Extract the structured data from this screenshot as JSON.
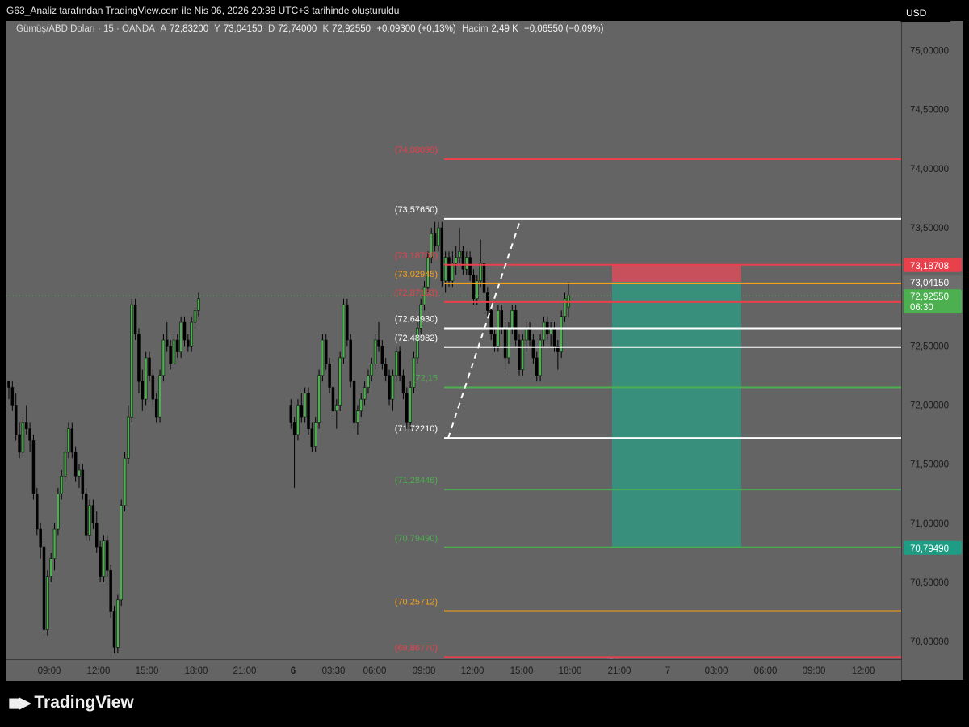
{
  "header": {
    "title": "G63_Analiz tarafından TradingView.com ile Nis 06, 2026 20:38 UTC+3 tarihinde oluşturuldu"
  },
  "legend": {
    "symbol": "Gümüş/ABD Doları · 15 · OANDA",
    "o_label": "A",
    "o_value": "72,83200",
    "h_label": "Y",
    "h_value": "73,04150",
    "l_label": "D",
    "l_value": "72,74000",
    "c_label": "K",
    "c_value": "72,92550",
    "change": "+0,09300 (+0,13%)",
    "volume_label": "Hacim",
    "volume_value": "2,49 K",
    "volume_change": "−0,06550 (−0,09%)"
  },
  "currency": "USD",
  "brand": "TradingView",
  "chart_data": {
    "type": "candlestick",
    "symbol": "Gümüş/ABD Doları",
    "interval": "15",
    "exchange": "OANDA",
    "ylim": [
      69.85,
      75.25
    ],
    "y_ticks": [
      {
        "v": 75.0,
        "label": "75,00000"
      },
      {
        "v": 74.5,
        "label": "74,50000"
      },
      {
        "v": 74.0,
        "label": "74,00000"
      },
      {
        "v": 73.5,
        "label": "73,50000"
      },
      {
        "v": 72.5,
        "label": "72,50000"
      },
      {
        "v": 72.0,
        "label": "72,00000"
      },
      {
        "v": 71.5,
        "label": "71,50000"
      },
      {
        "v": 71.0,
        "label": "71,00000"
      },
      {
        "v": 70.5,
        "label": "70,50000"
      },
      {
        "v": 70.0,
        "label": "70,00000"
      }
    ],
    "x_ticks": [
      {
        "label": "09:00",
        "bold": false
      },
      {
        "label": "12:00",
        "bold": false
      },
      {
        "label": "15:00",
        "bold": false
      },
      {
        "label": "18:00",
        "bold": false
      },
      {
        "label": "21:00",
        "bold": false
      },
      {
        "label": "6",
        "bold": true
      },
      {
        "label": "03:30",
        "bold": false
      },
      {
        "label": "06:00",
        "bold": false
      },
      {
        "label": "09:00",
        "bold": false
      },
      {
        "label": "12:00",
        "bold": false
      },
      {
        "label": "15:00",
        "bold": false
      },
      {
        "label": "18:00",
        "bold": false
      },
      {
        "label": "21:00",
        "bold": false
      },
      {
        "label": "7",
        "bold": false
      },
      {
        "label": "03:00",
        "bold": false
      },
      {
        "label": "06:00",
        "bold": false
      },
      {
        "label": "09:00",
        "bold": false
      },
      {
        "label": "12:00",
        "bold": false
      }
    ],
    "levels": [
      {
        "value": 74.0809,
        "label": "(74,08090)",
        "color": "#e8414c"
      },
      {
        "value": 73.5765,
        "label": "(73,57650)",
        "color": "#ffffff"
      },
      {
        "value": 73.18708,
        "label": "(73,18708)",
        "color": "#e8414c"
      },
      {
        "value": 73.02945,
        "label": "(73,02945)",
        "color": "#f6a01a"
      },
      {
        "value": 72.87183,
        "label": "(72,87183)",
        "color": "#e8414c"
      },
      {
        "value": 72.6493,
        "label": "(72,64930)",
        "color": "#ffffff"
      },
      {
        "value": 72.48982,
        "label": "(72,48982)",
        "color": "#ffffff"
      },
      {
        "value": 72.15,
        "label": "(72,15",
        "color": "#4caf50"
      },
      {
        "value": 71.7221,
        "label": "(71,72210)",
        "color": "#ffffff"
      },
      {
        "value": 71.28446,
        "label": "(71,28446)",
        "color": "#4caf50"
      },
      {
        "value": 70.7949,
        "label": "(70,79490)",
        "color": "#4caf50"
      },
      {
        "value": 70.25712,
        "label": "(70,25712)",
        "color": "#f6a01a"
      },
      {
        "value": 69.8677,
        "label": "(69,86770)",
        "color": "#e8414c"
      }
    ],
    "position": {
      "type": "short",
      "entry": 73.0415,
      "stop": 73.18708,
      "target": 70.7949,
      "stop_color": "#d94c5a",
      "target_color": "#2a9d84"
    },
    "price_tags": [
      {
        "value": 73.18708,
        "label": "73,18708",
        "bg": "#e8414c",
        "fg": "#ffffff"
      },
      {
        "value": 73.0415,
        "label": "73,04150",
        "bg": "#6e6e6e",
        "fg": "#ffffff"
      },
      {
        "value": 72.9255,
        "label": "72,92550",
        "sub": "06:30",
        "bg": "#4caf50",
        "fg": "#ffffff"
      },
      {
        "value": 70.7949,
        "label": "70,79490",
        "bg": "#1f9d84",
        "fg": "#ffffff"
      }
    ],
    "last_price": 72.9255,
    "candle_colors": {
      "up": "#4caf50",
      "down": "#000000"
    },
    "candles": [
      [
        72.2,
        72.2,
        72.05,
        72.15
      ],
      [
        72.15,
        72.2,
        71.95,
        72.0
      ],
      [
        72.0,
        72.1,
        71.7,
        71.75
      ],
      [
        71.75,
        71.85,
        71.55,
        71.6
      ],
      [
        71.6,
        71.9,
        71.55,
        71.85
      ],
      [
        71.85,
        72.0,
        71.75,
        71.8
      ],
      [
        71.8,
        71.85,
        71.6,
        71.7
      ],
      [
        71.7,
        71.75,
        71.2,
        71.25
      ],
      [
        71.25,
        71.3,
        70.9,
        70.95
      ],
      [
        70.95,
        71.0,
        70.7,
        70.8
      ],
      [
        70.8,
        70.85,
        70.05,
        70.1
      ],
      [
        70.1,
        70.6,
        70.05,
        70.55
      ],
      [
        70.55,
        70.75,
        70.5,
        70.7
      ],
      [
        70.7,
        71.0,
        70.6,
        70.95
      ],
      [
        70.95,
        71.3,
        70.9,
        71.25
      ],
      [
        71.25,
        71.45,
        71.2,
        71.4
      ],
      [
        71.4,
        71.65,
        71.35,
        71.6
      ],
      [
        71.6,
        71.85,
        71.55,
        71.8
      ],
      [
        71.8,
        71.85,
        71.55,
        71.6
      ],
      [
        71.6,
        71.65,
        71.35,
        71.4
      ],
      [
        71.4,
        71.5,
        71.3,
        71.45
      ],
      [
        71.45,
        71.5,
        71.2,
        71.25
      ],
      [
        71.25,
        71.3,
        70.85,
        70.9
      ],
      [
        70.9,
        71.2,
        70.85,
        71.15
      ],
      [
        71.15,
        71.2,
        70.95,
        71.0
      ],
      [
        71.0,
        71.1,
        70.75,
        70.8
      ],
      [
        70.8,
        70.85,
        70.5,
        70.55
      ],
      [
        70.55,
        70.9,
        70.5,
        70.85
      ],
      [
        70.85,
        70.9,
        70.55,
        70.6
      ],
      [
        70.6,
        70.65,
        70.2,
        70.25
      ],
      [
        70.25,
        70.3,
        69.9,
        69.95
      ],
      [
        69.95,
        70.4,
        69.9,
        70.35
      ],
      [
        70.35,
        71.2,
        70.3,
        71.15
      ],
      [
        71.15,
        71.6,
        71.1,
        71.55
      ],
      [
        71.55,
        72.0,
        71.5,
        71.9
      ],
      [
        71.9,
        72.9,
        71.85,
        72.85
      ],
      [
        72.85,
        72.9,
        72.55,
        72.6
      ],
      [
        72.6,
        72.65,
        72.1,
        72.2
      ],
      [
        72.2,
        72.3,
        71.95,
        72.05
      ],
      [
        72.05,
        72.45,
        72.0,
        72.4
      ],
      [
        72.4,
        72.45,
        72.2,
        72.25
      ],
      [
        72.25,
        72.3,
        72.0,
        72.05
      ],
      [
        72.05,
        72.1,
        71.85,
        71.9
      ],
      [
        71.9,
        72.3,
        71.85,
        72.25
      ],
      [
        72.25,
        72.6,
        72.2,
        72.55
      ],
      [
        72.55,
        72.7,
        72.45,
        72.5
      ],
      [
        72.5,
        72.55,
        72.3,
        72.35
      ],
      [
        72.35,
        72.6,
        72.3,
        72.55
      ],
      [
        72.55,
        72.6,
        72.4,
        72.45
      ],
      [
        72.45,
        72.75,
        72.4,
        72.7
      ],
      [
        72.7,
        72.75,
        72.5,
        72.55
      ],
      [
        72.55,
        72.6,
        72.45,
        72.5
      ],
      [
        72.5,
        72.75,
        72.45,
        72.7
      ],
      [
        72.7,
        72.85,
        72.65,
        72.8
      ],
      [
        72.8,
        72.95,
        72.75,
        72.9
      ],
      [
        72.0,
        72.05,
        71.8,
        71.85
      ],
      [
        71.85,
        71.9,
        71.3,
        71.75
      ],
      [
        71.75,
        72.05,
        71.7,
        72.0
      ],
      [
        72.0,
        72.1,
        71.85,
        71.9
      ],
      [
        71.9,
        72.15,
        71.85,
        72.1
      ],
      [
        72.1,
        72.15,
        71.75,
        71.8
      ],
      [
        71.8,
        71.85,
        71.6,
        71.65
      ],
      [
        71.65,
        71.9,
        71.6,
        71.85
      ],
      [
        71.85,
        72.3,
        71.8,
        72.25
      ],
      [
        72.25,
        72.6,
        72.2,
        72.55
      ],
      [
        72.55,
        72.6,
        72.3,
        72.35
      ],
      [
        72.35,
        72.4,
        72.1,
        72.15
      ],
      [
        72.15,
        72.2,
        71.9,
        71.95
      ],
      [
        71.95,
        72.05,
        71.8,
        72.0
      ],
      [
        72.0,
        72.45,
        71.95,
        72.4
      ],
      [
        72.4,
        72.9,
        72.35,
        72.85
      ],
      [
        72.85,
        72.9,
        72.5,
        72.55
      ],
      [
        72.55,
        72.6,
        72.15,
        72.2
      ],
      [
        72.2,
        72.25,
        71.8,
        71.85
      ],
      [
        71.85,
        72.0,
        71.75,
        71.95
      ],
      [
        71.95,
        72.1,
        71.9,
        72.05
      ],
      [
        72.05,
        72.2,
        72.0,
        72.15
      ],
      [
        72.15,
        72.3,
        72.1,
        72.25
      ],
      [
        72.25,
        72.4,
        72.2,
        72.35
      ],
      [
        72.35,
        72.6,
        72.3,
        72.55
      ],
      [
        72.55,
        72.7,
        72.45,
        72.5
      ],
      [
        72.5,
        72.55,
        72.3,
        72.35
      ],
      [
        72.35,
        72.4,
        72.2,
        72.25
      ],
      [
        72.25,
        72.3,
        72.0,
        72.05
      ],
      [
        72.05,
        72.3,
        71.95,
        72.25
      ],
      [
        72.25,
        72.5,
        72.2,
        72.45
      ],
      [
        72.45,
        72.5,
        72.2,
        72.25
      ],
      [
        72.25,
        72.3,
        72.05,
        72.1
      ],
      [
        72.1,
        72.15,
        71.8,
        71.85
      ],
      [
        71.85,
        72.2,
        71.8,
        72.15
      ],
      [
        72.15,
        72.45,
        72.1,
        72.4
      ],
      [
        72.4,
        72.7,
        72.35,
        72.65
      ],
      [
        72.65,
        72.9,
        72.6,
        72.85
      ],
      [
        72.85,
        73.05,
        72.8,
        73.0
      ],
      [
        73.0,
        73.3,
        72.95,
        73.25
      ],
      [
        73.25,
        73.5,
        73.2,
        73.45
      ],
      [
        73.45,
        73.55,
        73.3,
        73.35
      ],
      [
        73.35,
        73.55,
        73.3,
        73.5
      ],
      [
        73.5,
        73.55,
        73.0,
        73.05
      ],
      [
        73.05,
        73.3,
        72.95,
        73.25
      ],
      [
        73.25,
        73.3,
        73.0,
        73.05
      ],
      [
        73.05,
        73.3,
        73.0,
        73.2
      ],
      [
        73.2,
        73.35,
        73.1,
        73.25
      ],
      [
        73.25,
        73.5,
        73.2,
        73.3
      ],
      [
        73.3,
        73.35,
        73.1,
        73.15
      ],
      [
        73.15,
        73.3,
        73.1,
        73.25
      ],
      [
        73.25,
        73.3,
        73.05,
        73.1
      ],
      [
        73.1,
        73.15,
        72.85,
        72.9
      ],
      [
        72.9,
        73.1,
        72.85,
        73.05
      ],
      [
        73.05,
        73.4,
        73.0,
        73.2
      ],
      [
        73.2,
        73.25,
        72.9,
        72.95
      ],
      [
        72.95,
        73.0,
        72.75,
        72.8
      ],
      [
        72.8,
        72.85,
        72.55,
        72.6
      ],
      [
        72.6,
        72.65,
        72.45,
        72.5
      ],
      [
        72.5,
        72.85,
        72.45,
        72.8
      ],
      [
        72.8,
        72.85,
        72.6,
        72.65
      ],
      [
        72.65,
        72.7,
        72.3,
        72.4
      ],
      [
        72.4,
        72.7,
        72.35,
        72.65
      ],
      [
        72.65,
        72.85,
        72.6,
        72.8
      ],
      [
        72.8,
        72.85,
        72.5,
        72.55
      ],
      [
        72.55,
        72.6,
        72.25,
        72.3
      ],
      [
        72.3,
        72.6,
        72.25,
        72.55
      ],
      [
        72.55,
        72.7,
        72.45,
        72.65
      ],
      [
        72.65,
        72.7,
        72.5,
        72.55
      ],
      [
        72.55,
        72.6,
        72.35,
        72.4
      ],
      [
        72.4,
        72.45,
        72.2,
        72.25
      ],
      [
        72.25,
        72.6,
        72.2,
        72.55
      ],
      [
        72.55,
        72.75,
        72.5,
        72.7
      ],
      [
        72.7,
        72.75,
        72.55,
        72.6
      ],
      [
        72.6,
        72.7,
        72.5,
        72.65
      ],
      [
        72.65,
        72.7,
        72.45,
        72.5
      ],
      [
        72.5,
        72.55,
        72.3,
        72.45
      ],
      [
        72.45,
        72.8,
        72.4,
        72.75
      ],
      [
        72.75,
        72.95,
        72.7,
        72.9
      ],
      [
        72.83,
        73.0415,
        72.74,
        72.9255
      ]
    ]
  }
}
